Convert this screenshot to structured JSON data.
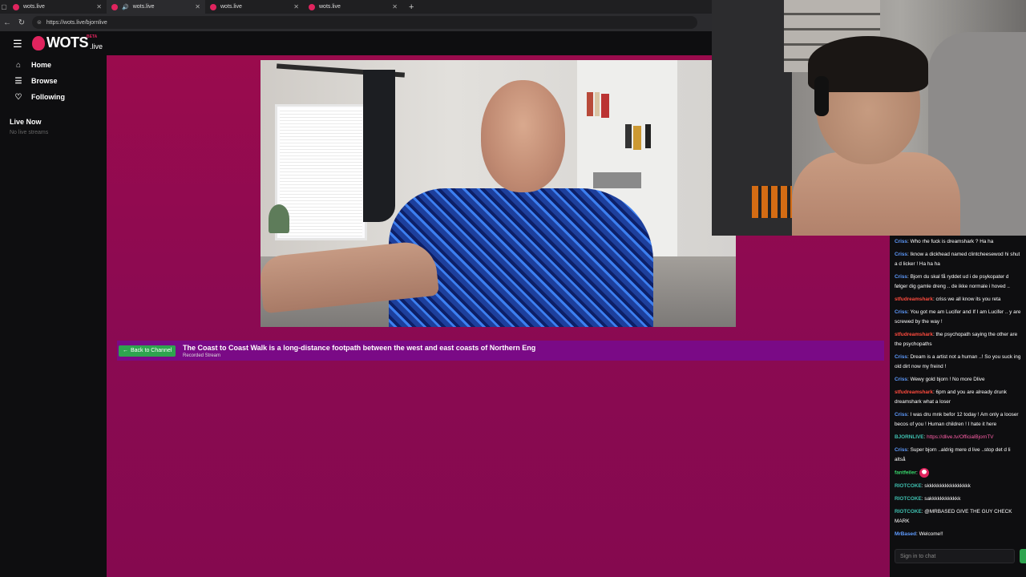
{
  "browser": {
    "tabs": [
      {
        "title": "wots.live",
        "active": false
      },
      {
        "title": "wots.live",
        "active": true
      },
      {
        "title": "wots.live",
        "active": false
      },
      {
        "title": "wots.live",
        "active": false
      }
    ],
    "url": "https://wots.live/bjornlive"
  },
  "site": {
    "logo_word": "WOTS",
    "logo_tld": ".live",
    "logo_badge": "BETA",
    "nav": [
      {
        "label": "Home",
        "icon": "home-icon"
      },
      {
        "label": "Browse",
        "icon": "list-icon"
      },
      {
        "label": "Following",
        "icon": "heart-icon"
      }
    ],
    "live_now_label": "Live Now",
    "no_live_label": "No live streams"
  },
  "stream": {
    "back_label": "Back to Channel",
    "title": "The Coast to Coast Walk is a long-distance footpath between the west and east coasts of Northern Eng",
    "subtitle": "Recorded Stream"
  },
  "chat": {
    "messages": [
      {
        "user": "Criss",
        "color": "blue",
        "text": "Who rhe fuck is dreamshark ? Ha ha"
      },
      {
        "user": "Criss",
        "color": "blue",
        "text": "Iknow a dickhead named clintcheesewod hi shut a d licker ! Ha ha ha"
      },
      {
        "user": "Criss",
        "color": "blue",
        "text": "Bjorn du skal få ryddet ud i de psykopater d følger dig gamle dreng .. de ikke normale i hoved .."
      },
      {
        "user": "stfudreamshark",
        "color": "red",
        "text": "criss we all know its you reta"
      },
      {
        "user": "Criss",
        "color": "blue",
        "text": "You got me am Lucifer and If I am Lucifer .. y are screwed by the way !"
      },
      {
        "user": "stfudreamshark",
        "color": "red",
        "text": "the psychopath saying the other are the psychopaths"
      },
      {
        "user": "Criss",
        "color": "blue",
        "text": "Dream is a artist not a human ..! So you suck ing old dirt now my freind !"
      },
      {
        "user": "Criss",
        "color": "blue",
        "text": "Wewy gold bjorn ! No more Dlive"
      },
      {
        "user": "stfudreamshark",
        "color": "red",
        "text": "6pm and you are already drunk dreamshark what a loser"
      },
      {
        "user": "Criss",
        "color": "blue",
        "text": "I was dru mnk befor 12 today ! Am only a looser becos of you ! Human children ! I hate it here"
      },
      {
        "user": "BJORNLIVE",
        "color": "teal",
        "text": "https://dlive.tv/OfficialBjornTV",
        "is_link": true
      },
      {
        "user": "Criss",
        "color": "blue",
        "text": "Super bjorn ..aldrig mere d live ..stop det d li altså"
      },
      {
        "user": "fantfeiler",
        "color": "green",
        "text": "",
        "emoji": true
      },
      {
        "user": "RIOTCOKE",
        "color": "teal",
        "text": "skkkkkkkkkkkkkkkkk"
      },
      {
        "user": "RIOTCOKE",
        "color": "teal",
        "text": "sakkkkkkkkkkkk"
      },
      {
        "user": "RIOTCOKE",
        "color": "teal",
        "text": "@MRBASED GIVE THE GUY CHECK MARK"
      },
      {
        "user": "MrBased",
        "color": "blue",
        "text": "Welcome!!"
      }
    ],
    "input_placeholder": "Sign in to chat"
  }
}
